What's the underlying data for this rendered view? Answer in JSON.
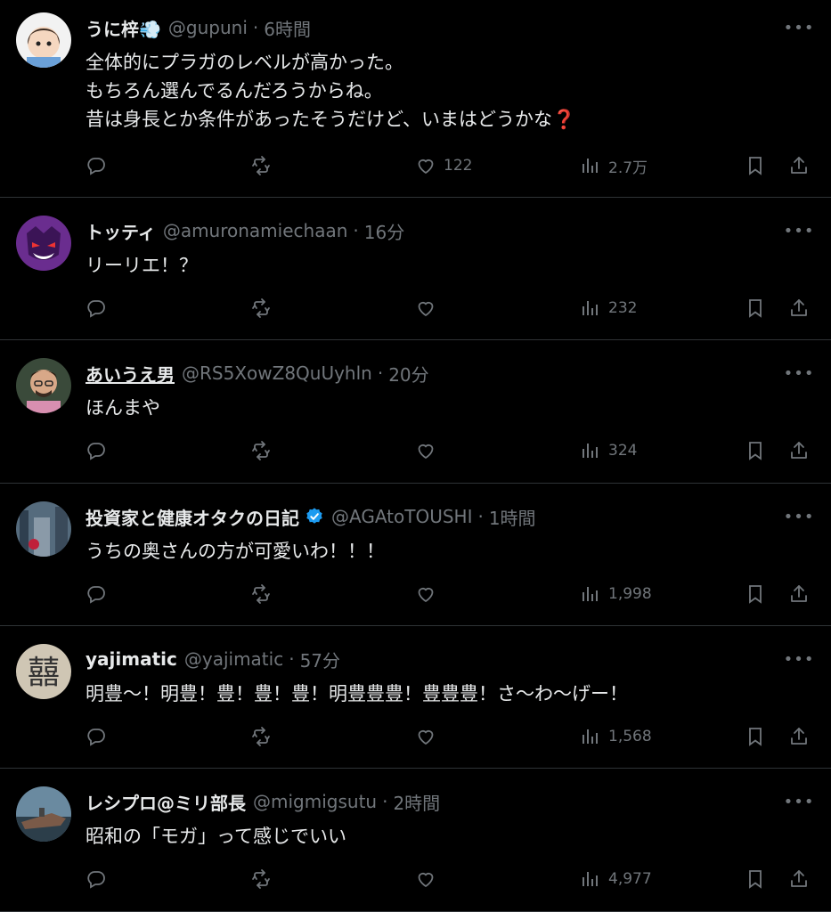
{
  "tweets": [
    {
      "name": "うに梓💨",
      "handle": "@gupuni",
      "time": "6時間",
      "lines": [
        "全体的にプラガのレベルが高かった。",
        "もちろん選んでるんだろうからね。",
        "昔は身長とか条件があったそうだけど、いまはどうかな❓"
      ],
      "likes": "122",
      "views": "2.7万",
      "avatar_color": "#f2f2f2"
    },
    {
      "name": "トッティ",
      "handle": "@amuronamiechaan",
      "time": "16分",
      "lines": [
        "リーリエ！？"
      ],
      "likes": "",
      "views": "232",
      "avatar_color": "#6a2d8f"
    },
    {
      "name": "あいうえ男",
      "handle": "@RS5XowZ8QuUyhln",
      "time": "20分",
      "lines": [
        "ほんまや"
      ],
      "likes": "",
      "views": "324",
      "avatar_color": "#8a6a5a"
    },
    {
      "name": "投資家と健康オタクの日記",
      "handle": "@AGAtoTOUSHI",
      "time": "1時間",
      "lines": [
        "うちの奥さんの方が可愛いわ！！！"
      ],
      "likes": "",
      "views": "1,998",
      "avatar_color": "#556b7d",
      "verified": true
    },
    {
      "name": "yajimatic",
      "handle": "@yajimatic",
      "time": "57分",
      "lines": [
        "明豊〜！明豊！豊！豊！豊！明豊豊豊！豊豊豊！さ〜わ〜げー！"
      ],
      "likes": "",
      "views": "1,568",
      "avatar_color": "#cfc6b4"
    },
    {
      "name": "レシプロ@ミリ部長",
      "handle": "@migmigsutu",
      "time": "2時間",
      "lines": [
        "昭和の「モガ」って感じでいい"
      ],
      "likes": "",
      "views": "4,977",
      "avatar_color": "#4a6b7e"
    }
  ],
  "colors": {
    "background": "#000000",
    "text": "#e7e9ea",
    "muted": "#71767b",
    "divider": "#2f3336",
    "verified": "#1d9bf0"
  },
  "icons": [
    "reply-icon",
    "retweet-icon",
    "like-icon",
    "views-icon",
    "bookmark-icon",
    "share-icon",
    "more-icon",
    "verified-icon"
  ]
}
